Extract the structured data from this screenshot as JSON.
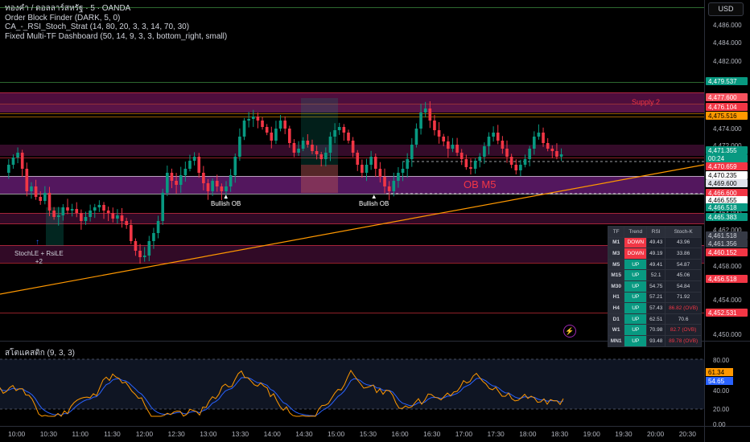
{
  "legend": {
    "symbol": "ทองคำ / ดอลลาร์สหรัฐ · 5 · OANDA",
    "ind1": "Order Block Finder (DARK, 5, 0)",
    "ind2": "CA_-_RSI_Stoch_Strat (14, 80, 20, 3, 3, 14, 70, 30)",
    "ind3": "Fixed Multi-TF Dashboard (50, 14, 9, 3, 3, bottom_right, small)"
  },
  "currency": "USD",
  "price_axis": {
    "ticks": [
      "4,486.000",
      "4,484.000",
      "4,482.000",
      "4,474.000",
      "4,472.000",
      "4,464.000",
      "4,462.000",
      "4,458.000",
      "4,454.000",
      "4,450.000"
    ],
    "ticks_ypos_index": [
      0,
      1,
      2,
      3,
      4,
      5,
      6,
      7,
      8,
      9
    ]
  },
  "price_tags": [
    {
      "text": "4,479.537",
      "color": "#089981",
      "fg": "#ffffff"
    },
    {
      "text": "4,477.600",
      "color": "#f7525f",
      "fg": "#ffffff"
    },
    {
      "text": "4,476.104",
      "color": "#f23645",
      "fg": "#ffffff"
    },
    {
      "text": "4,475.516",
      "color": "#ff9800",
      "fg": "#000000"
    },
    {
      "text": "4,471.355",
      "color": "#089981",
      "fg": "#ffffff"
    },
    {
      "text": "00:24",
      "color": "#089981",
      "fg": "#ffffff"
    },
    {
      "text": "4,470.659",
      "color": "#f23645",
      "fg": "#ffffff"
    },
    {
      "text": "4,470.235",
      "color": "#ffffff",
      "fg": "#000000"
    },
    {
      "text": "4,469.600",
      "color": "#e0e3eb",
      "fg": "#000000"
    },
    {
      "text": "4,466.600",
      "color": "#f23645",
      "fg": "#ffffff"
    },
    {
      "text": "4,466.555",
      "color": "#ffffff",
      "fg": "#000000"
    },
    {
      "text": "4,466.518",
      "color": "#089981",
      "fg": "#ffffff"
    },
    {
      "text": "4,465.383",
      "color": "#089981",
      "fg": "#ffffff"
    },
    {
      "text": "4,461.518",
      "color": "#363a45",
      "fg": "#d1d4dc"
    },
    {
      "text": "4,461.356",
      "color": "#363a45",
      "fg": "#d1d4dc"
    },
    {
      "text": "4,460.152",
      "color": "#f23645",
      "fg": "#ffffff"
    },
    {
      "text": "4,456.518",
      "color": "#f23645",
      "fg": "#ffffff"
    },
    {
      "text": "4,452.531",
      "color": "#f23645",
      "fg": "#ffffff"
    }
  ],
  "time_axis": [
    "10:00",
    "10:30",
    "11:00",
    "11:30",
    "12:00",
    "12:30",
    "13:00",
    "13:30",
    "14:00",
    "14:30",
    "15:00",
    "15:30",
    "16:00",
    "16:30",
    "17:00",
    "17:30",
    "18:00",
    "18:30",
    "19:00",
    "19:30",
    "20:00",
    "20:30"
  ],
  "annotations": {
    "bullish_ob_1": "Bullish OB",
    "bullish_ob_2": "Bullish OB",
    "ob_m5": "OB M5",
    "supply_2": "Supply 2",
    "stoch_entry": "StochLE + RsiLE",
    "stoch_entry_count": "+2"
  },
  "dashboard": {
    "headers": [
      "TF",
      "Trend",
      "RSI",
      "Stoch-K"
    ],
    "rows": [
      {
        "tf": "M1",
        "trend": "DOWN",
        "rsi": "49.43",
        "stoch": "43.96",
        "ovb": false
      },
      {
        "tf": "M3",
        "trend": "DOWN",
        "rsi": "49.19",
        "stoch": "33.86",
        "ovb": false
      },
      {
        "tf": "M5",
        "trend": "UP",
        "rsi": "49.41",
        "stoch": "54.87",
        "ovb": false
      },
      {
        "tf": "M15",
        "trend": "UP",
        "rsi": "52.1",
        "stoch": "45.06",
        "ovb": false
      },
      {
        "tf": "M30",
        "trend": "UP",
        "rsi": "54.75",
        "stoch": "54.84",
        "ovb": false
      },
      {
        "tf": "H1",
        "trend": "UP",
        "rsi": "57.21",
        "stoch": "71.92",
        "ovb": false
      },
      {
        "tf": "H4",
        "trend": "UP",
        "rsi": "57.43",
        "stoch": "86.82 (OVB)",
        "ovb": true
      },
      {
        "tf": "D1",
        "trend": "UP",
        "rsi": "62.51",
        "stoch": "70.6",
        "ovb": false
      },
      {
        "tf": "W1",
        "trend": "UP",
        "rsi": "70.98",
        "stoch": "82.7 (OVB)",
        "ovb": true
      },
      {
        "tf": "MN1",
        "trend": "UP",
        "rsi": "93.48",
        "stoch": "89.78 (OVB)",
        "ovb": true
      }
    ]
  },
  "sub_pane": {
    "title": "สโตแคสติก (9, 3, 3)",
    "ticks": [
      "80.00",
      "40.00",
      "20.00",
      "0.00"
    ],
    "k_tag": "61.34",
    "d_tag": "54.65",
    "k_color": "#ff9800",
    "d_color": "#2962ff"
  },
  "colors": {
    "up": "#089981",
    "down": "#f23645",
    "zone": "#7b1f6b",
    "trendline": "#ff9800"
  }
}
